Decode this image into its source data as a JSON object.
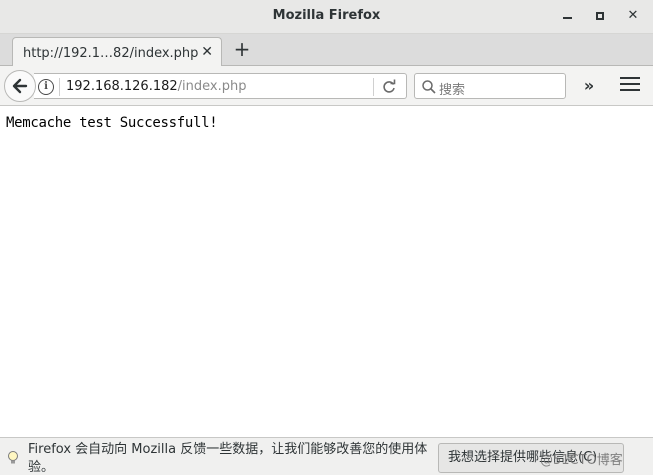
{
  "window": {
    "title": "Mozilla Firefox",
    "minimize_glyph": "—",
    "close_glyph": "✕"
  },
  "tab": {
    "label": "http://192.1…82/index.php",
    "close_glyph": "✕",
    "new_tab_glyph": "+"
  },
  "navbar": {
    "url_host": "192.168.126.182",
    "url_path": "/index.php",
    "search_placeholder": "搜索",
    "overflow_glyph": "»",
    "icons": [
      "back-arrow-icon",
      "info-icon",
      "reload-icon",
      "search-icon",
      "hamburger-menu-icon"
    ]
  },
  "content": {
    "text": "Memcache test Successfull!"
  },
  "notification": {
    "message": "Firefox 会自动向 Mozilla 反馈一些数据，让我们能够改善您的使用体验。",
    "button_label": "我想选择提供哪些信息(C)",
    "watermark": "@51CTO博客"
  },
  "colors": {
    "titlebar_bg": "#e8e8e7",
    "toolbar_bg": "#f3f3f2",
    "notification_bg": "#f0f0ef"
  }
}
